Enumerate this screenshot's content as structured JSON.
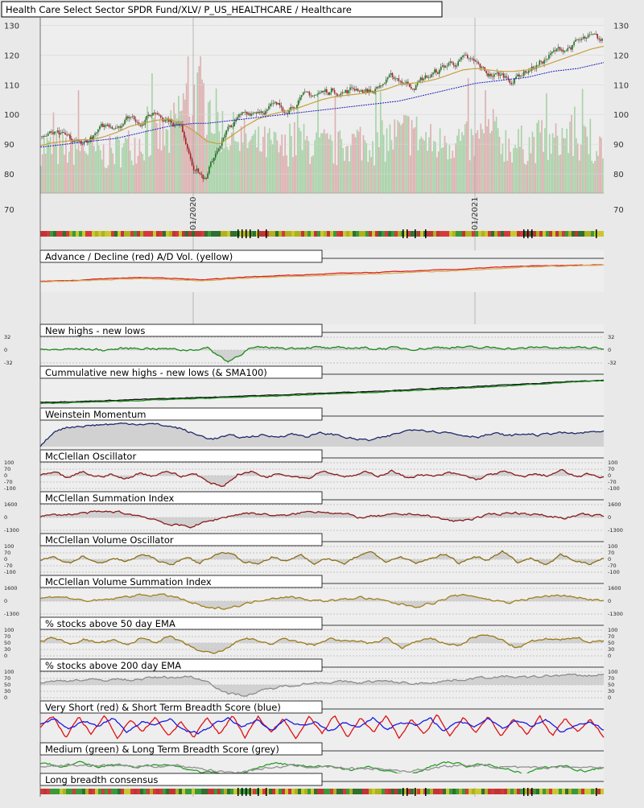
{
  "chart_data": {
    "type": "line",
    "title": "Health Care Select Sector SPDR Fund/XLV/ P_US_HEALTHCARE / Healthcare",
    "date_labels": [
      "01/2020",
      "01/2021"
    ],
    "price_axis": {
      "ylim": [
        70,
        132
      ],
      "ticks": [
        70,
        80,
        90,
        100,
        110,
        120,
        130
      ]
    },
    "price_series": {
      "close_anchors": [
        92.5,
        93,
        91,
        89.5,
        92,
        95,
        97,
        100,
        98,
        101,
        99.5,
        96,
        84,
        78,
        90,
        96,
        100,
        102,
        103,
        101.5,
        105,
        106,
        107,
        108.5,
        108,
        109,
        108,
        111,
        112,
        110,
        112,
        114,
        117,
        118.5,
        116.5,
        113.5,
        113,
        112,
        115,
        117,
        120,
        122,
        124,
        125,
        124
      ],
      "ma_anchors": [
        89.5,
        90.5,
        91,
        91.5,
        91.5,
        92.5,
        94,
        96,
        97,
        98,
        98.5,
        97,
        94.5,
        91,
        90,
        93,
        96,
        98.5,
        100,
        101,
        102,
        103.5,
        105,
        106,
        106.5,
        107,
        107.5,
        108.5,
        110,
        110.5,
        111,
        112,
        113.5,
        115,
        115.5,
        115,
        114.5,
        114.5,
        115,
        116,
        117.5,
        119,
        120.5,
        122,
        123
      ],
      "long_ma_anchors": [
        89,
        89.5,
        90,
        90.5,
        91,
        91.5,
        92,
        93,
        94,
        95,
        96,
        96.5,
        97,
        97,
        97.5,
        98,
        98.5,
        99,
        99.5,
        100,
        100.5,
        101,
        101.5,
        102,
        102.5,
        103,
        103.5,
        104,
        104.5,
        105.5,
        106.5,
        107.5,
        108.5,
        109.5,
        110.5,
        111,
        111.5,
        112,
        112.5,
        113.5,
        114.5,
        115,
        115.5,
        116.5,
        117.5
      ]
    },
    "volume_profile": [
      0.5,
      0.45,
      0.45,
      0.5,
      0.45,
      0.4,
      0.45,
      0.5,
      0.55,
      0.6,
      0.55,
      0.9,
      1.0,
      0.95,
      0.7,
      0.6,
      0.55,
      0.5,
      0.5,
      0.45,
      0.55,
      0.5,
      0.5,
      0.45,
      0.5,
      0.55,
      0.5,
      0.55,
      0.6,
      0.65,
      0.55,
      0.5,
      0.55,
      0.55,
      0.5,
      0.6,
      0.55,
      0.5,
      0.5,
      0.55,
      0.5,
      0.6,
      0.55,
      0.5,
      0.5
    ],
    "panels": [
      {
        "key": "ad",
        "title": "Advance / Decline (red) A/D Vol. (yellow)",
        "labels": [],
        "series": [
          {
            "name": "Advance / Decline",
            "color": "#e02020",
            "anchors": [
              0.3,
              0.32,
              0.38,
              0.42,
              0.45,
              0.4,
              0.36,
              0.42,
              0.48,
              0.52,
              0.55,
              0.6,
              0.62,
              0.66,
              0.7,
              0.74,
              0.78,
              0.84,
              0.88,
              0.9,
              0.92,
              0.94
            ]
          },
          {
            "name": "A/D Vol.",
            "color": "#d2b15a",
            "anchors": [
              0.28,
              0.3,
              0.34,
              0.38,
              0.4,
              0.36,
              0.32,
              0.38,
              0.44,
              0.47,
              0.5,
              0.54,
              0.57,
              0.6,
              0.65,
              0.68,
              0.74,
              0.78,
              0.84,
              0.88,
              0.9,
              0.93
            ]
          }
        ]
      },
      {
        "key": "nhnl",
        "title": "New highs - new lows",
        "labels": [
          "32",
          "0",
          "-32"
        ],
        "series": [
          {
            "name": "New highs - new lows",
            "color": "#1c8a1c",
            "anchors": [
              0.5,
              0.52,
              0.55,
              0.5,
              0.56,
              0.58,
              0.55,
              0.5,
              0.58,
              0.05,
              0.55,
              0.6,
              0.58,
              0.62,
              0.55,
              0.6,
              0.56,
              0.58,
              0.55,
              0.6,
              0.62,
              0.58,
              0.6,
              0.55,
              0.62,
              0.58,
              0.6,
              0.56
            ]
          }
        ]
      },
      {
        "key": "cum",
        "title": "Cummulative new highs - new lows (& SMA100)",
        "labels": [],
        "series": [
          {
            "name": "Cummulative new highs - new lows",
            "color": "#111111",
            "anchors": [
              0.1,
              0.14,
              0.2,
              0.26,
              0.32,
              0.38,
              0.45,
              0.52,
              0.6,
              0.68,
              0.78,
              0.88,
              0.95
            ]
          },
          {
            "name": "SMA100",
            "color": "#1c8a1c",
            "anchors": [
              0.05,
              0.1,
              0.16,
              0.22,
              0.28,
              0.34,
              0.41,
              0.48,
              0.56,
              0.64,
              0.74,
              0.85,
              0.93
            ]
          }
        ]
      },
      {
        "key": "wm",
        "title": "Weinstein Momentum",
        "labels": [],
        "series": [
          {
            "name": "Weinstein Momentum",
            "color": "#1f2a6b",
            "anchors": [
              0.0,
              0.65,
              0.78,
              0.82,
              0.86,
              0.88,
              0.9,
              0.88,
              0.82,
              0.7,
              0.45,
              0.3,
              0.42,
              0.35,
              0.45,
              0.38,
              0.5,
              0.4,
              0.52,
              0.45,
              0.3,
              0.25,
              0.35,
              0.55,
              0.7,
              0.62,
              0.55,
              0.45,
              0.4,
              0.5,
              0.42,
              0.5,
              0.45,
              0.55,
              0.5,
              0.55,
              0.6
            ]
          }
        ]
      },
      {
        "key": "mo",
        "title": "McClellan Oscillator",
        "labels": [
          "100",
          "70",
          "0",
          "-70",
          "-100"
        ],
        "series": [
          {
            "name": "McClellan Oscillator",
            "color": "#8b1a1a",
            "anchors": [
              0.5,
              0.6,
              0.4,
              0.65,
              0.45,
              0.55,
              0.35,
              0.6,
              0.5,
              0.7,
              0.45,
              0.6,
              0.2,
              0.1,
              0.55,
              0.65,
              0.45,
              0.6,
              0.5,
              0.4,
              0.7,
              0.55,
              0.45,
              0.62,
              0.5,
              0.7,
              0.4,
              0.55,
              0.45,
              0.6,
              0.5,
              0.35,
              0.55,
              0.65,
              0.45,
              0.55,
              0.5,
              0.7,
              0.45,
              0.55,
              0.45
            ]
          }
        ]
      },
      {
        "key": "msi",
        "title": "McClellan Summation Index",
        "labels": [
          "1600",
          "0",
          "-1300"
        ],
        "series": [
          {
            "name": "McClellan Summation Index",
            "color": "#8b1a1a",
            "anchors": [
              0.55,
              0.6,
              0.65,
              0.7,
              0.72,
              0.6,
              0.45,
              0.2,
              0.15,
              0.35,
              0.55,
              0.68,
              0.62,
              0.55,
              0.7,
              0.75,
              0.65,
              0.5,
              0.55,
              0.6,
              0.65,
              0.5,
              0.35,
              0.45,
              0.6,
              0.7,
              0.65,
              0.55,
              0.5,
              0.6,
              0.55
            ]
          }
        ]
      },
      {
        "key": "mvo",
        "title": "McClellan Volume Oscillator",
        "labels": [
          "100",
          "70",
          "0",
          "-70",
          "-100"
        ],
        "series": [
          {
            "name": "McClellan Volume Oscillator",
            "color": "#8a6d12",
            "anchors": [
              0.45,
              0.6,
              0.35,
              0.65,
              0.3,
              0.55,
              0.4,
              0.7,
              0.5,
              0.25,
              0.6,
              0.35,
              0.65,
              0.8,
              0.45,
              0.3,
              0.6,
              0.4,
              0.7,
              0.35,
              0.55,
              0.3,
              0.65,
              0.75,
              0.4,
              0.6,
              0.3,
              0.55,
              0.7,
              0.35,
              0.6,
              0.5,
              0.85,
              0.4,
              0.55,
              0.3,
              0.65,
              0.45,
              0.35,
              0.55
            ]
          }
        ]
      },
      {
        "key": "mvsi",
        "title": "McClellan Volume Summation Index",
        "labels": [
          "1600",
          "0",
          "-1300"
        ],
        "series": [
          {
            "name": "McClellan Volume Summation Index",
            "color": "#a0801a",
            "anchors": [
              0.6,
              0.7,
              0.55,
              0.5,
              0.6,
              0.72,
              0.75,
              0.7,
              0.45,
              0.2,
              0.25,
              0.4,
              0.6,
              0.68,
              0.6,
              0.5,
              0.55,
              0.65,
              0.55,
              0.4,
              0.3,
              0.45,
              0.7,
              0.72,
              0.55,
              0.45,
              0.6,
              0.7,
              0.72,
              0.6,
              0.5
            ]
          }
        ]
      },
      {
        "key": "e50",
        "title": "% stocks above 50 day EMA",
        "labels": [
          "100",
          "70",
          "50",
          "30",
          "0"
        ],
        "series": [
          {
            "name": "% stocks above 50 day EMA",
            "color": "#9b7a16",
            "anchors": [
              0.55,
              0.7,
              0.45,
              0.65,
              0.5,
              0.6,
              0.4,
              0.7,
              0.55,
              0.75,
              0.45,
              0.2,
              0.05,
              0.3,
              0.7,
              0.6,
              0.45,
              0.65,
              0.5,
              0.4,
              0.7,
              0.55,
              0.6,
              0.45,
              0.7,
              0.3,
              0.55,
              0.65,
              0.5,
              0.4,
              0.75,
              0.8,
              0.6,
              0.3,
              0.55,
              0.65,
              0.6,
              0.75,
              0.55,
              0.6
            ]
          }
        ]
      },
      {
        "key": "e200",
        "title": "% stocks above 200 day EMA",
        "labels": [
          "100",
          "70",
          "50",
          "30",
          "0"
        ],
        "series": [
          {
            "name": "% stocks above 200 day EMA",
            "color": "#8c8c8c",
            "anchors": [
              0.6,
              0.65,
              0.7,
              0.68,
              0.72,
              0.7,
              0.78,
              0.8,
              0.82,
              0.6,
              0.15,
              0.1,
              0.3,
              0.45,
              0.55,
              0.6,
              0.62,
              0.58,
              0.65,
              0.6,
              0.55,
              0.62,
              0.68,
              0.75,
              0.8,
              0.82,
              0.78,
              0.85,
              0.88,
              0.85,
              0.9
            ]
          }
        ]
      },
      {
        "key": "vs",
        "title": "Very Short (red) & Short Term Breadth Score (blue)",
        "labels": [],
        "series": [
          {
            "name": "Very Short",
            "color": "#e01010",
            "anchors": [
              0.5,
              0.9,
              0.1,
              0.85,
              0.2,
              0.95,
              0.05,
              0.8,
              0.3,
              0.9,
              0.15,
              0.7,
              0.05,
              0.85,
              0.2,
              0.95,
              0.1,
              0.9,
              0.3,
              0.8,
              0.05,
              0.9,
              0.2,
              0.95,
              0.1,
              0.85,
              0.25,
              0.9,
              0.05,
              0.8,
              0.2,
              0.95,
              0.15,
              0.85,
              0.3,
              0.9,
              0.1,
              0.8,
              0.2,
              0.9,
              0.15,
              0.85,
              0.3,
              0.8,
              0.1
            ]
          },
          {
            "name": "Short Term Breadth Score",
            "color": "#1a1ae0",
            "anchors": [
              0.6,
              0.8,
              0.4,
              0.75,
              0.5,
              0.85,
              0.3,
              0.7,
              0.55,
              0.8,
              0.35,
              0.25,
              0.6,
              0.8,
              0.5,
              0.75,
              0.35,
              0.8,
              0.55,
              0.7,
              0.3,
              0.65,
              0.5,
              0.85,
              0.4,
              0.7,
              0.55,
              0.8,
              0.35,
              0.7,
              0.5,
              0.85,
              0.45,
              0.75,
              0.55,
              0.8,
              0.3,
              0.55,
              0.7,
              0.4
            ]
          }
        ]
      },
      {
        "key": "ml",
        "title": "Medium (green) & Long Term Breadth Score (grey)",
        "labels": [],
        "series": [
          {
            "name": "Medium",
            "color": "#2a9a2a",
            "anchors": [
              0.7,
              0.6,
              0.75,
              0.55,
              0.65,
              0.5,
              0.7,
              0.6,
              0.4,
              0.3,
              0.2,
              0.5,
              0.7,
              0.65,
              0.55,
              0.6,
              0.45,
              0.55,
              0.35,
              0.25,
              0.55,
              0.75,
              0.6,
              0.65,
              0.5,
              0.3,
              0.55,
              0.6,
              0.4,
              0.55
            ]
          },
          {
            "name": "Long Term Breadth Score",
            "color": "#909090",
            "anchors": [
              0.6,
              0.62,
              0.65,
              0.6,
              0.62,
              0.58,
              0.6,
              0.62,
              0.55,
              0.4,
              0.35,
              0.45,
              0.55,
              0.6,
              0.58,
              0.55,
              0.5,
              0.52,
              0.45,
              0.4,
              0.5,
              0.6,
              0.62,
              0.6,
              0.55,
              0.5,
              0.55,
              0.58,
              0.55,
              0.58
            ]
          }
        ]
      },
      {
        "key": "lbc",
        "title": "Long breadth consensus",
        "labels": [],
        "series": []
      }
    ],
    "strip_colors": [
      "#3a9a3a",
      "#c8c830",
      "#d43a3a",
      "#2f6f2f",
      "#b0b020",
      "#c23434"
    ]
  }
}
